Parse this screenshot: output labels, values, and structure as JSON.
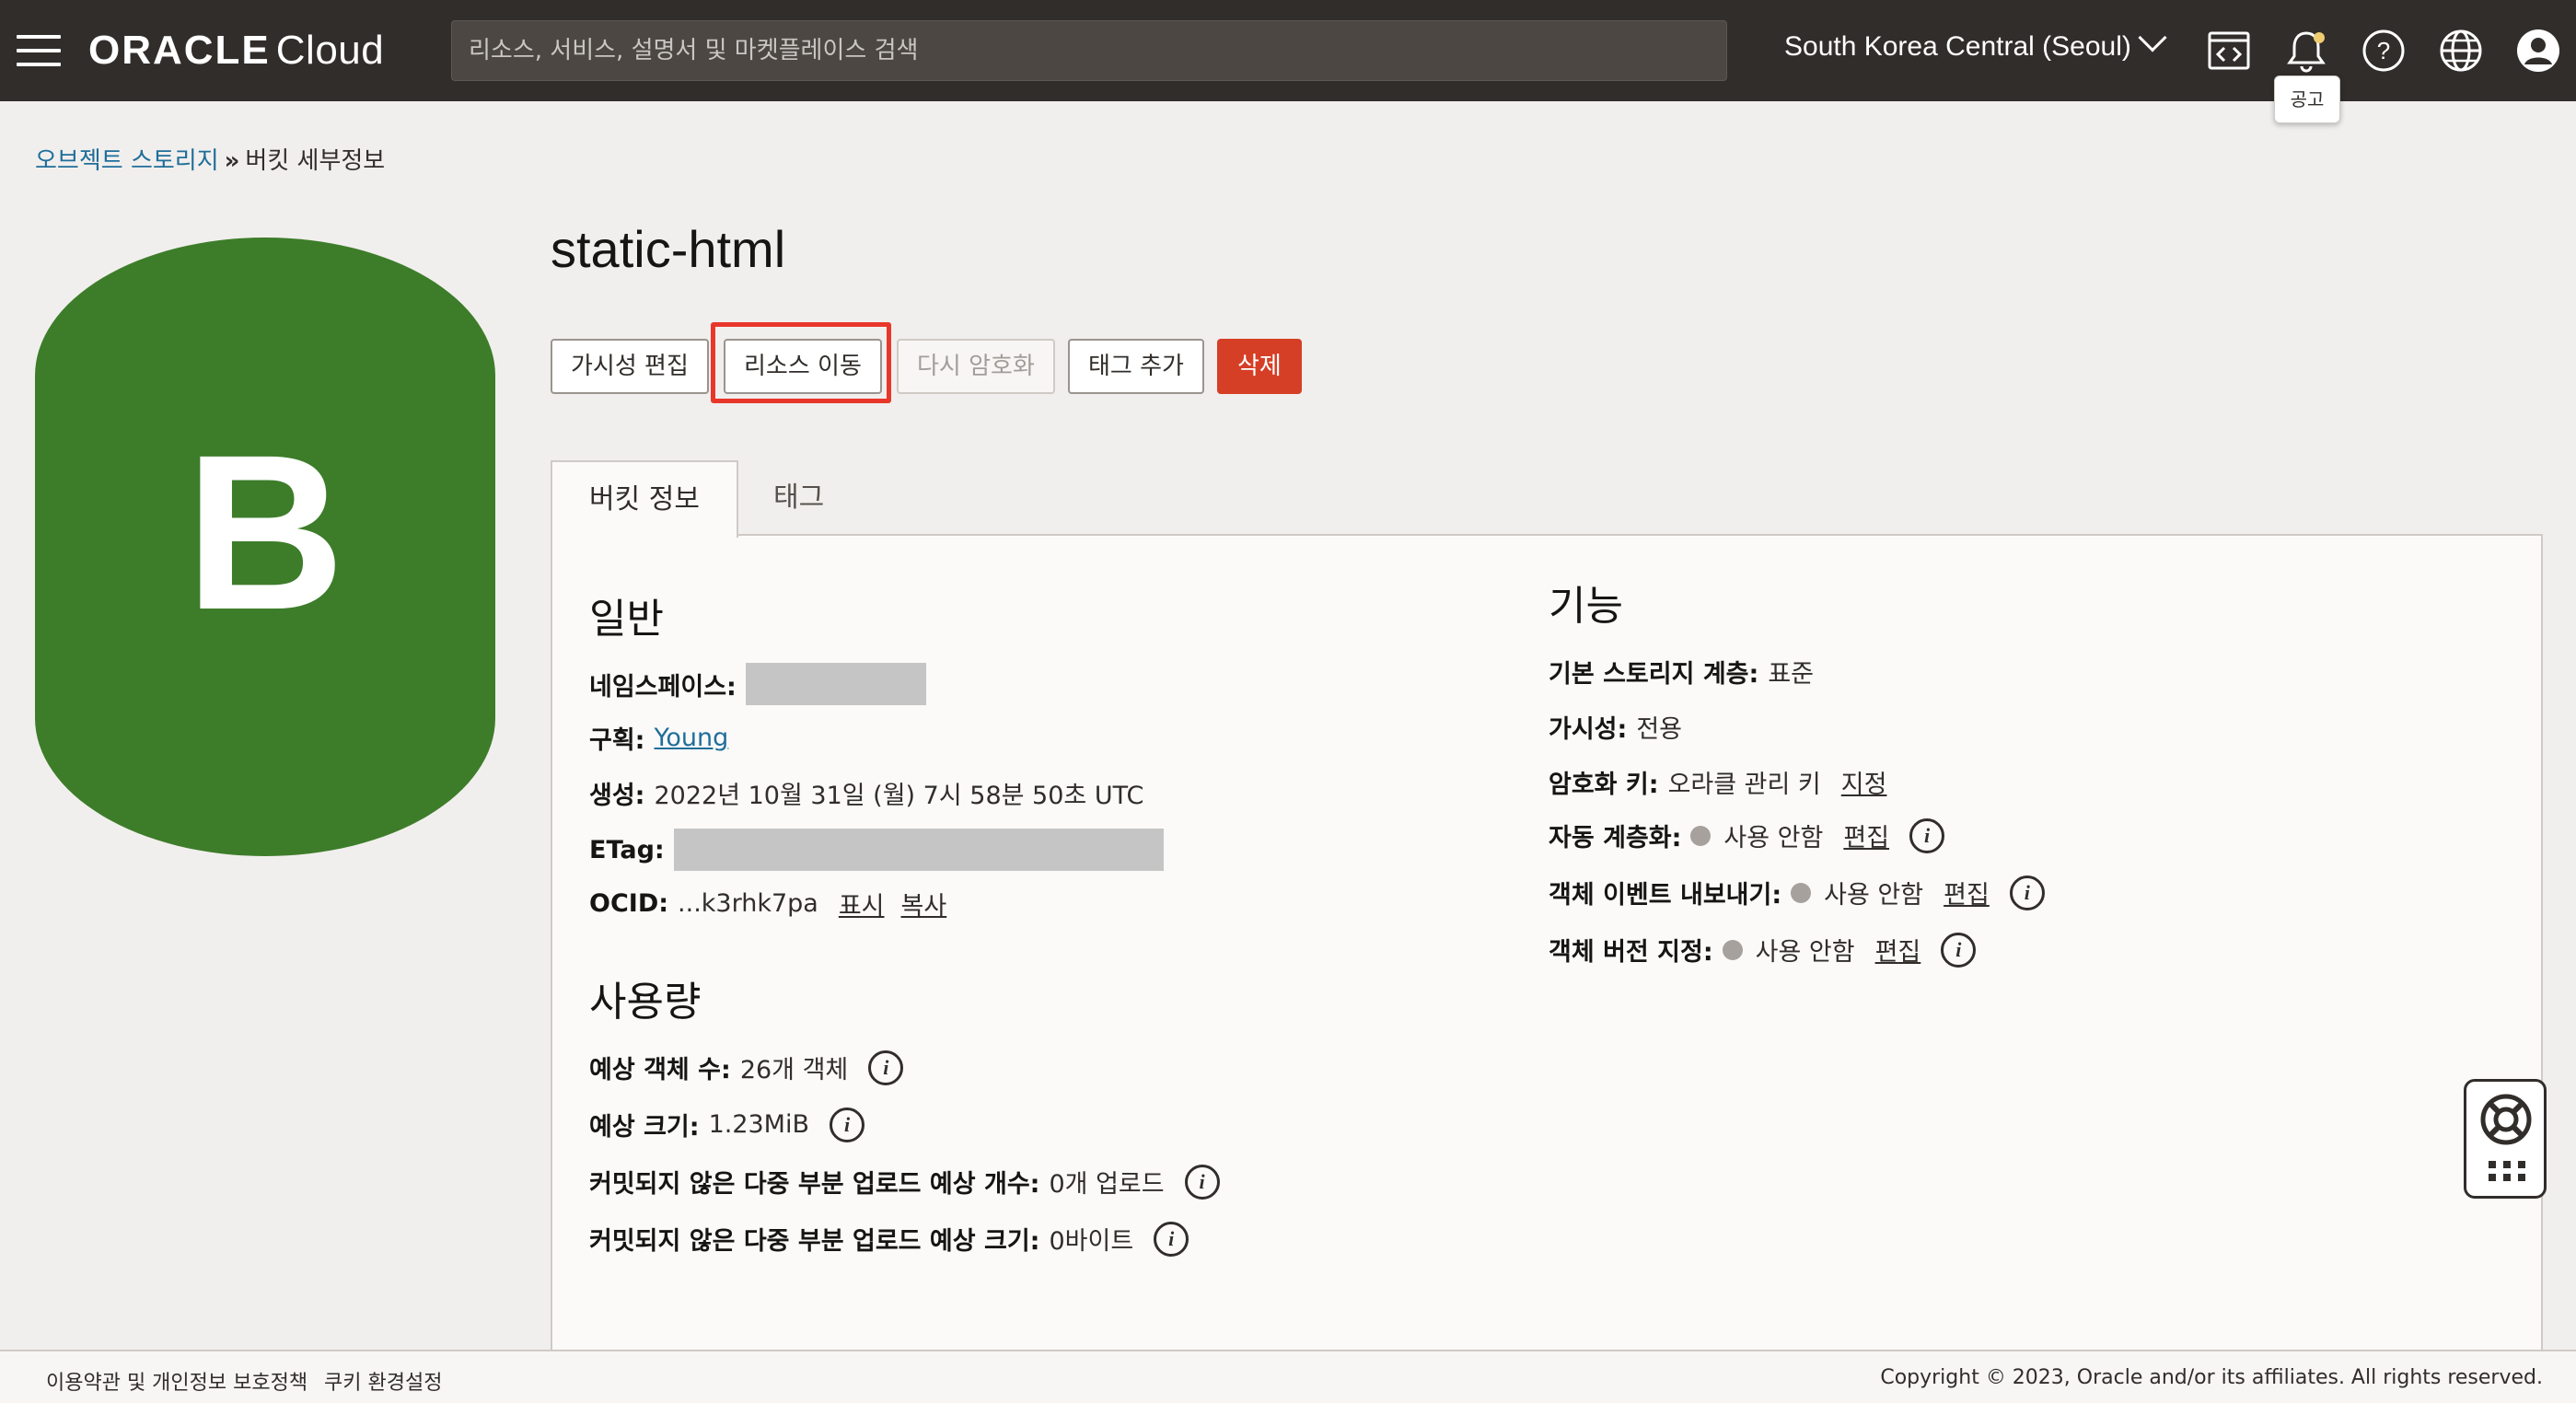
{
  "header": {
    "brand_main": "ORACLE",
    "brand_sub": "Cloud",
    "search_placeholder": "리소스, 서비스, 설명서 및 마켓플레이스 검색",
    "region": "South Korea Central (Seoul)",
    "notification_tooltip": "공고"
  },
  "breadcrumb": {
    "parent": "오브젝트 스토리지",
    "separator": "»",
    "current": "버킷 세부정보"
  },
  "bucket": {
    "letter": "B",
    "name": "static-html"
  },
  "actions": {
    "edit_visibility": "가시성 편집",
    "move_resource": "리소스 이동",
    "re_encrypt": "다시 암호화",
    "add_tags": "태그 추가",
    "delete": "삭제"
  },
  "tabs": {
    "bucket_info": "버킷 정보",
    "tags": "태그"
  },
  "general": {
    "heading": "일반",
    "namespace_label": "네임스페이스:",
    "compartment_label": "구획:",
    "compartment_value": "Young",
    "created_label": "생성:",
    "created_value": "2022년 10월 31일 (월) 7시 58분 50초 UTC",
    "etag_label": "ETag:",
    "ocid_label": "OCID:",
    "ocid_value": "...k3rhk7pa",
    "ocid_show": "표시",
    "ocid_copy": "복사"
  },
  "usage": {
    "heading": "사용량",
    "object_count_label": "예상 객체 수:",
    "object_count_value": "26개 객체",
    "size_label": "예상 크기:",
    "size_value": "1.23MiB",
    "uncommitted_count_label": "커밋되지 않은 다중 부분 업로드 예상 개수:",
    "uncommitted_count_value": "0개 업로드",
    "uncommitted_size_label": "커밋되지 않은 다중 부분 업로드 예상 크기:",
    "uncommitted_size_value": "0바이트"
  },
  "features": {
    "heading": "기능",
    "storage_tier_label": "기본 스토리지 계층:",
    "storage_tier_value": "표준",
    "visibility_label": "가시성:",
    "visibility_value": "전용",
    "encryption_label": "암호화 키:",
    "encryption_value": "오라클 관리 키",
    "encryption_assign": "지정",
    "auto_tiering_label": "자동 계층화:",
    "auto_tiering_value": "사용 안함",
    "auto_tiering_edit": "편집",
    "events_label": "객체 이벤트 내보내기:",
    "events_value": "사용 안함",
    "events_edit": "편집",
    "versioning_label": "객체 버전 지정:",
    "versioning_value": "사용 안함",
    "versioning_edit": "편집",
    "info_glyph": "i"
  },
  "footer": {
    "terms": "이용약관 및 개인정보 보호정책",
    "cookies": "쿠키 환경설정",
    "copyright": "Copyright © 2023, Oracle and/or its affiliates. All rights reserved."
  },
  "colors": {
    "topbar": "#312d2a",
    "bucket_green": "#3d7d2a",
    "danger": "#d53f26",
    "link": "#1f6e9a",
    "highlight": "#e8372a"
  }
}
